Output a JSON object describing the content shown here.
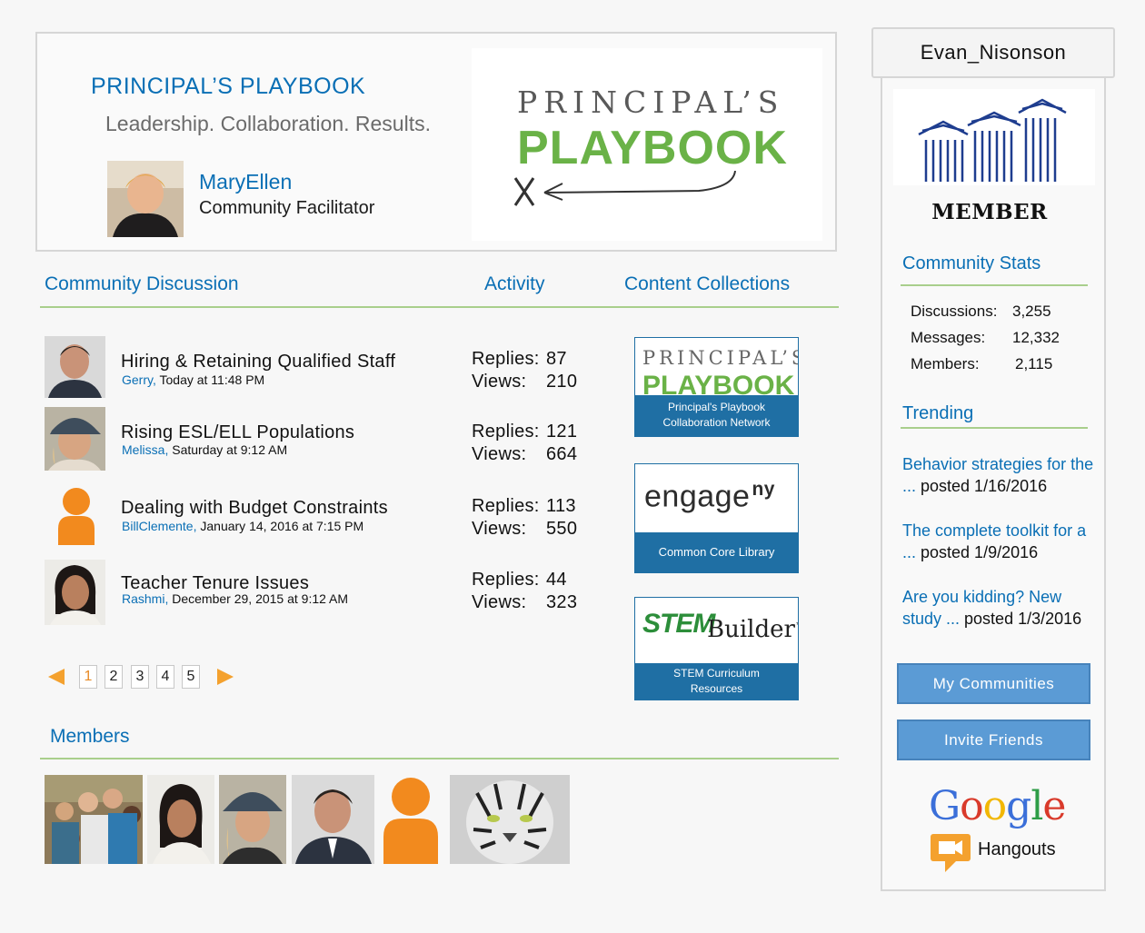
{
  "header": {
    "title": "PRINCIPAL’S PLAYBOOK",
    "tagline": "Leadership. Collaboration. Results.",
    "facilitator_name": "MaryEllen",
    "facilitator_role": "Community Facilitator",
    "logo_top": "PRINCIPAL’S",
    "logo_bottom": "PLAYBOOK"
  },
  "sections": {
    "discussion": "Community Discussion",
    "activity": "Activity",
    "collections": "Content Collections",
    "members": "Members"
  },
  "discussions": [
    {
      "title": "Hiring & Retaining Qualified Staff",
      "author": "Gerry,",
      "when": " Today at 11:48 PM",
      "replies_label": "Replies:",
      "replies": "87",
      "views_label": "Views:",
      "views": "210"
    },
    {
      "title": "Rising ESL/ELL Populations",
      "author": "Melissa,",
      "when": " Saturday at 9:12 AM",
      "replies_label": "Replies:",
      "replies": "121",
      "views_label": "Views:",
      "views": "664"
    },
    {
      "title": "Dealing with Budget Constraints",
      "author": "BillClemente,",
      "when": " January 14, 2016 at 7:15 PM",
      "replies_label": "Replies:",
      "replies": "113",
      "views_label": "Views:",
      "views": "550"
    },
    {
      "title": "Teacher Tenure Issues",
      "author": "Rashmi,",
      "when": " December 29, 2015 at 9:12 AM",
      "replies_label": "Replies:",
      "replies": "44",
      "views_label": "Views:",
      "views": "323"
    }
  ],
  "collections": [
    {
      "logo_top": "PRINCIPAL’S",
      "logo_bottom": "PLAYBOOK",
      "band_line1": "Principal's Playbook",
      "band_line2": "Collaboration Network"
    },
    {
      "logo": "engage",
      "logo_sup": "ny",
      "band_line1": "Common Core Library"
    },
    {
      "logo_stem": "STEM",
      "logo_builder": "Builder",
      "logo_tm": "™",
      "band_line1": "STEM Curriculum",
      "band_line2": "Resources"
    }
  ],
  "pagination": {
    "pages": [
      "1",
      "2",
      "3",
      "4",
      "5"
    ],
    "active": "1"
  },
  "sidebar": {
    "username": "Evan_Nisonson",
    "member_label": "MEMBER",
    "stats_title": "Community Stats",
    "stats": [
      {
        "label": "Discussions:",
        "value": "3,255"
      },
      {
        "label": "Messages:",
        "value": "12,332"
      },
      {
        "label": "Members:",
        "value": "2,115"
      }
    ],
    "trending_title": "Trending",
    "trending": [
      {
        "link": "Behavior strategies for the ...",
        "posted": " posted 1/16/2016"
      },
      {
        "link": "The complete toolkit for a ...",
        "posted": " posted 1/9/2016"
      },
      {
        "link": "Are you kidding? New study ...",
        "posted": " posted 1/3/2016"
      }
    ],
    "btn_communities": "My Communities",
    "btn_invite": "Invite Friends",
    "google": "Google",
    "hangouts": "Hangouts"
  },
  "colors": {
    "accent": "#0a6fb5",
    "rule": "#a9cf8c",
    "orange": "#f28a1e",
    "button": "#5b9bd5",
    "band": "#1f6fa4"
  }
}
